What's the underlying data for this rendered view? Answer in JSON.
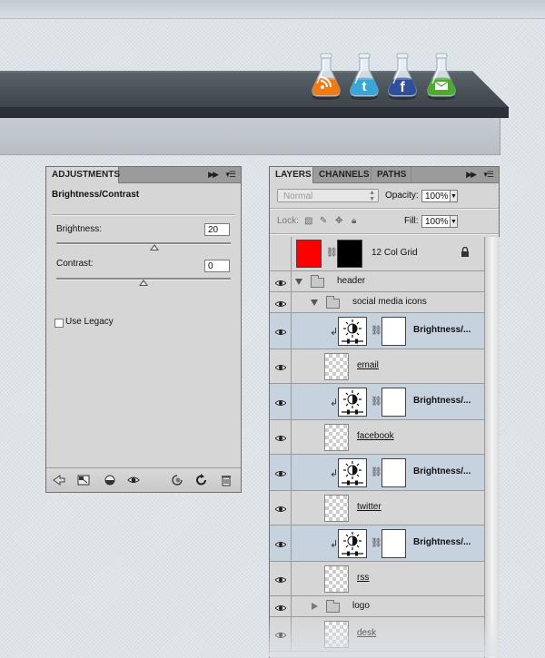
{
  "social_icons": [
    {
      "icon": "rss-icon",
      "color": "#f07a14"
    },
    {
      "icon": "twitter-icon",
      "color": "#3aa6d8"
    },
    {
      "icon": "facebook-icon",
      "color": "#2f4f9a"
    },
    {
      "icon": "email-icon",
      "color": "#4caa2e"
    }
  ],
  "adjustments": {
    "tab": "ADJUSTMENTS",
    "title": "Brightness/Contrast",
    "brightness_label": "Brightness:",
    "brightness_value": "20",
    "brightness_slider_fraction": 0.56,
    "contrast_label": "Contrast:",
    "contrast_value": "0",
    "contrast_slider_fraction": 0.5,
    "use_legacy_label": "Use Legacy",
    "use_legacy_checked": false,
    "footer_icons": [
      "back-arrow-icon",
      "expand-view-icon",
      "clip-to-layer-icon",
      "visibility-eye-icon",
      "view-previous-icon",
      "reset-icon",
      "trash-icon"
    ]
  },
  "layers": {
    "tabs": [
      "LAYERS",
      "CHANNELS",
      "PATHS"
    ],
    "blend_mode": "Normal",
    "opacity_label": "Opacity:",
    "opacity_value": "100%",
    "lock_label": "Lock:",
    "fill_label": "Fill:",
    "fill_value": "100%",
    "rows": [
      {
        "name": "12 Col Grid",
        "type": "layer-with-mask",
        "visible": false,
        "thumb_color": "#ff0000",
        "mask_color": "#000000",
        "locked": true
      },
      {
        "name": "header",
        "type": "group",
        "expanded": true,
        "indent": 0
      },
      {
        "name": "social media icons",
        "type": "group",
        "expanded": true,
        "indent": 1
      },
      {
        "name": "Brightness/...",
        "type": "adjustment",
        "selected": true
      },
      {
        "name": "email",
        "type": "layer"
      },
      {
        "name": "Brightness/...",
        "type": "adjustment",
        "selected": true
      },
      {
        "name": "facebook",
        "type": "layer"
      },
      {
        "name": "Brightness/...",
        "type": "adjustment",
        "selected": true
      },
      {
        "name": "twitter",
        "type": "layer"
      },
      {
        "name": "Brightness/...",
        "type": "adjustment",
        "selected": true
      },
      {
        "name": "rss",
        "type": "layer"
      },
      {
        "name": "logo",
        "type": "group",
        "expanded": false,
        "indent": 1
      },
      {
        "name": "desk",
        "type": "layer"
      }
    ]
  }
}
